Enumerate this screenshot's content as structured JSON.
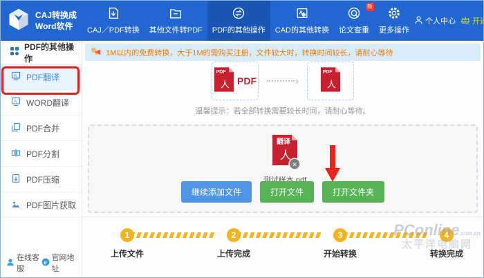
{
  "app": {
    "title_line1": "CAJ转换成",
    "title_line2": "Word软件"
  },
  "header": {
    "tabs": [
      {
        "label": "CAJ／PDF转换",
        "active": false
      },
      {
        "label": "其他文件转PDF",
        "active": false
      },
      {
        "label": "PDF的其他操作",
        "active": true
      },
      {
        "label": "CAD的其他转换",
        "active": false
      },
      {
        "label": "论文查重",
        "active": false,
        "badge": "新"
      },
      {
        "label": "更多操作",
        "active": false
      }
    ],
    "user_center": "个人中心",
    "vip": "开通VIP",
    "window_controls": {
      "menu": "≡",
      "minimize": "—",
      "maximize": "□",
      "close": "✕"
    }
  },
  "sidebar": {
    "section": "PDF的其他操作",
    "items": [
      {
        "label": "PDF翻译",
        "selected": true
      },
      {
        "label": "WORD翻译",
        "selected": false
      },
      {
        "label": "PDF合并",
        "selected": false
      },
      {
        "label": "PDF分割",
        "selected": false
      },
      {
        "label": "PDF压缩",
        "selected": false
      },
      {
        "label": "PDF图片获取",
        "selected": false
      }
    ],
    "footer": {
      "service": "在线客服",
      "website": "官网地址"
    }
  },
  "notice": {
    "text": "1M以内的免费转换，大于1M的需购买注册，文件较大时，转换时间较长，请耐心等待"
  },
  "convert": {
    "pdf_icon_text": "PDF",
    "source_label": "PDF",
    "adobe_glyph": "人",
    "tip": "温馨提示：若全部转换需要较长时间，请耐心等待。"
  },
  "upload": {
    "file_badge": "翻译",
    "file_name": "测试样本.pdf",
    "remove_glyph": "✕",
    "buttons": [
      {
        "label": "继续添加文件",
        "style": "blue"
      },
      {
        "label": "打开文件",
        "style": "green"
      },
      {
        "label": "打开文件夹",
        "style": "green"
      }
    ]
  },
  "steps": [
    {
      "num": "1",
      "label": "上传文件"
    },
    {
      "num": "2",
      "label": "上传完成"
    },
    {
      "num": "3",
      "label": "开始转换"
    },
    {
      "num": "4",
      "label": "转换完成"
    }
  ],
  "watermark": {
    "line1": "PConline",
    "suffix": ".com.cn",
    "line2": "太平洋电脑网"
  },
  "colors": {
    "header_blue": "#2267d1",
    "active_tab_blue": "#1956b6",
    "pdf_red": "#c8202f",
    "step_yellow": "#f4b41f",
    "notice_orange": "#f07c00",
    "annotation_red": "#e31c1c"
  }
}
